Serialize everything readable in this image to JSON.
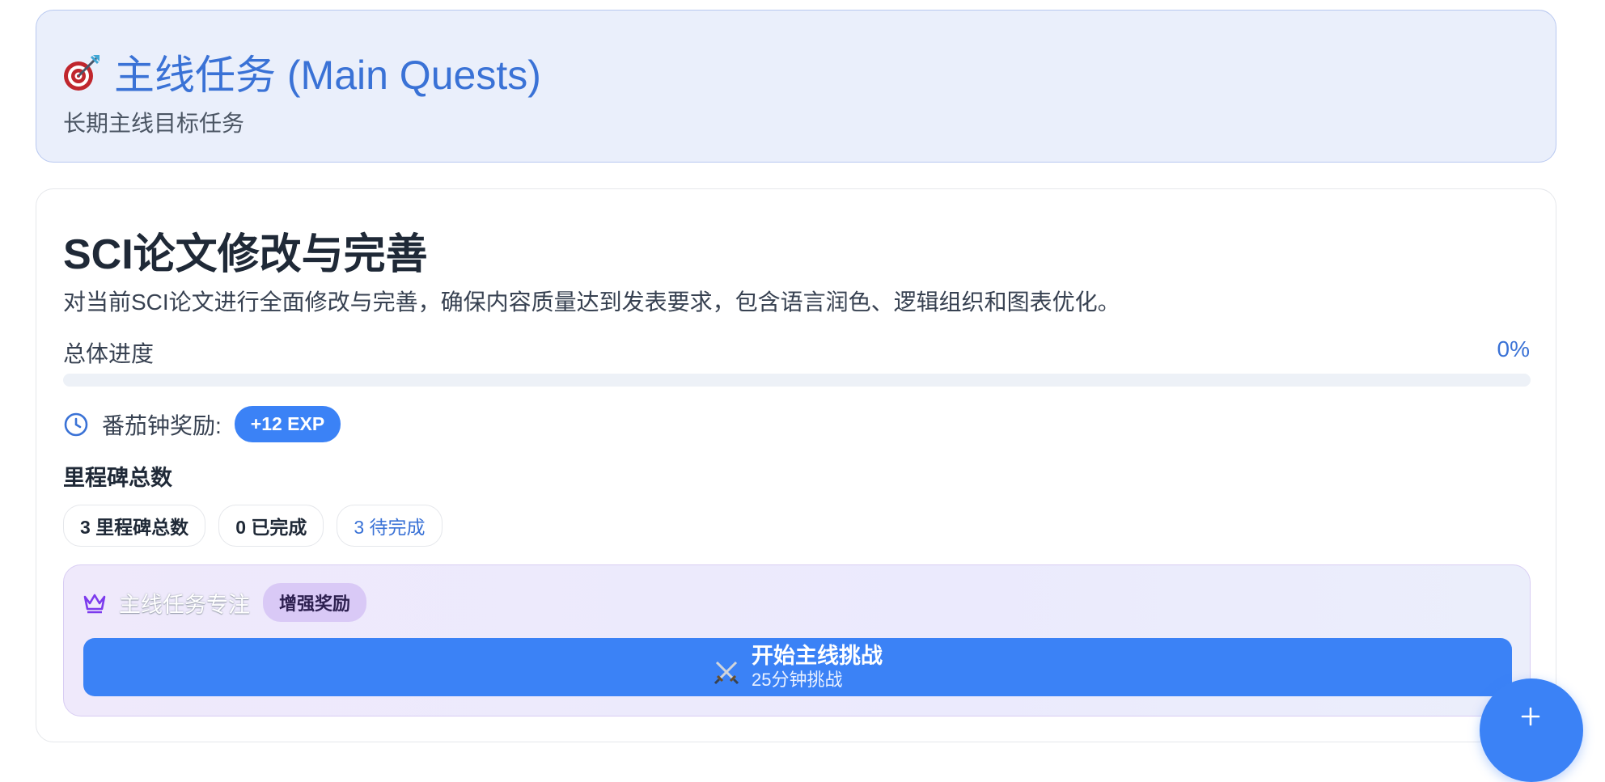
{
  "header": {
    "icon": "target-icon",
    "title": "主线任务 (Main Quests)",
    "subtitle": "长期主线目标任务"
  },
  "quest": {
    "title": "SCI论文修改与完善",
    "description": "对当前SCI论文进行全面修改与完善，确保内容质量达到发表要求，包含语言润色、逻辑组织和图表优化。",
    "progress_label": "总体进度",
    "progress_text": "0%",
    "progress_fraction": 0,
    "reward_icon": "clock-icon",
    "reward_label": "番茄钟奖励:",
    "reward_badge": "+12 EXP",
    "milestone_heading": "里程碑总数",
    "milestones": {
      "total": "3 里程碑总数",
      "done": "0 已完成",
      "pending": "3 待完成"
    },
    "focus": {
      "icon": "crown-icon",
      "title": "主线任务专注",
      "badge": "增强奖励",
      "button_icon": "crossed-swords-icon",
      "button_label": "开始主线挑战",
      "button_sub": "25分钟挑战"
    }
  },
  "fab": {
    "icon": "plus-icon"
  },
  "colors": {
    "accent": "#3b82f6",
    "accent_text": "#3a72d6",
    "header_bg": "#eaeffb",
    "focus_bg": "#efe9fb",
    "boost_badge_bg": "#d9c9f6"
  }
}
